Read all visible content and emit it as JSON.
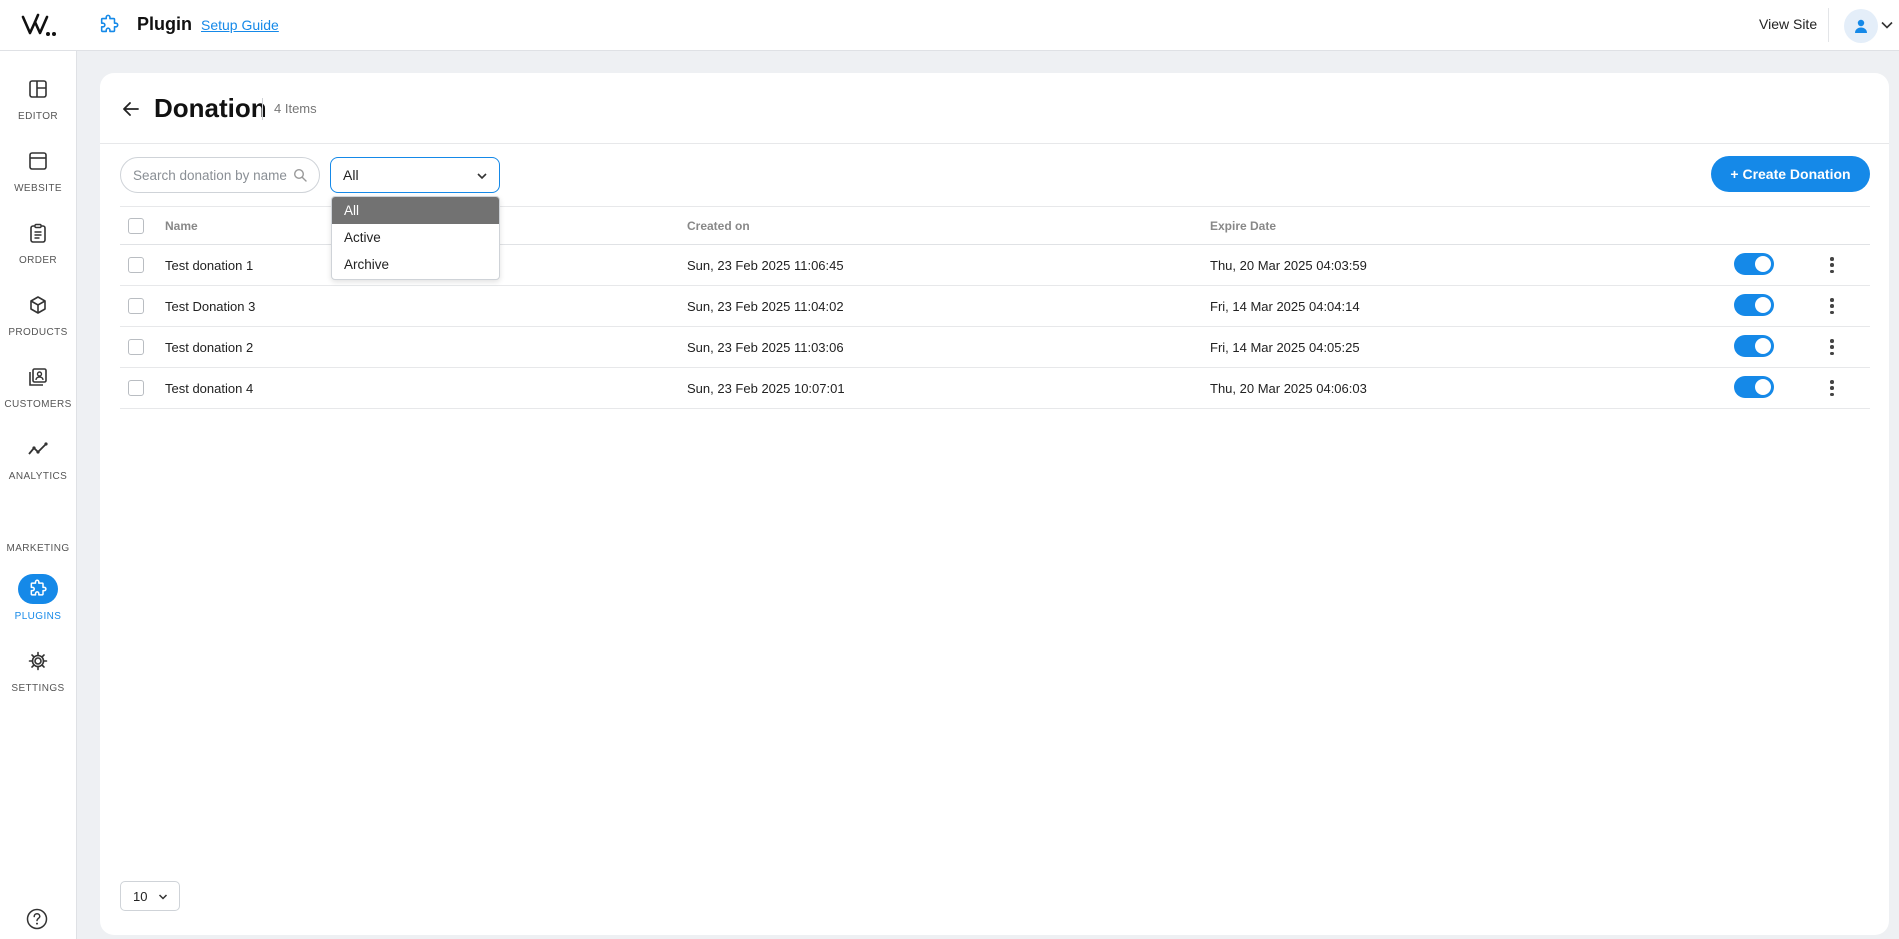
{
  "header": {
    "title": "Plugin",
    "setup_guide": "Setup Guide",
    "view_site": "View Site"
  },
  "sidebar": {
    "items": [
      {
        "label": "EDITOR",
        "icon": "editor-icon"
      },
      {
        "label": "WEBSITE",
        "icon": "website-icon"
      },
      {
        "label": "ORDER",
        "icon": "order-icon"
      },
      {
        "label": "PRODUCTS",
        "icon": "products-icon"
      },
      {
        "label": "CUSTOMERS",
        "icon": "customers-icon"
      },
      {
        "label": "ANALYTICS",
        "icon": "analytics-icon"
      },
      {
        "label": "MARKETING",
        "icon": "marketing-icon"
      },
      {
        "label": "PLUGINS",
        "icon": "puzzle-icon",
        "active": true
      },
      {
        "label": "SETTINGS",
        "icon": "gear-icon"
      }
    ]
  },
  "page": {
    "title": "Donation",
    "count": "4 Items"
  },
  "toolbar": {
    "search_placeholder": "Search donation by name",
    "filter_value": "All",
    "filter_options": [
      "All",
      "Active",
      "Archive"
    ],
    "create_label": "+ Create Donation"
  },
  "table": {
    "headers": {
      "name": "Name",
      "created": "Created on",
      "expire": "Expire Date"
    },
    "rows": [
      {
        "name": "Test donation 1",
        "created": "Sun, 23 Feb 2025 11:06:45",
        "expire": "Thu, 20 Mar 2025 04:03:59",
        "enabled": true
      },
      {
        "name": "Test Donation 3",
        "created": "Sun, 23 Feb 2025 11:04:02",
        "expire": "Fri, 14 Mar 2025 04:04:14",
        "enabled": true
      },
      {
        "name": "Test donation 2",
        "created": "Sun, 23 Feb 2025 11:03:06",
        "expire": "Fri, 14 Mar 2025 04:05:25",
        "enabled": true
      },
      {
        "name": "Test donation 4",
        "created": "Sun, 23 Feb 2025 10:07:01",
        "expire": "Thu, 20 Mar 2025 04:06:03",
        "enabled": true
      }
    ]
  },
  "pagination": {
    "page_size": "10"
  },
  "colors": {
    "accent": "#1589e8",
    "selected_option_bg": "#727272"
  }
}
